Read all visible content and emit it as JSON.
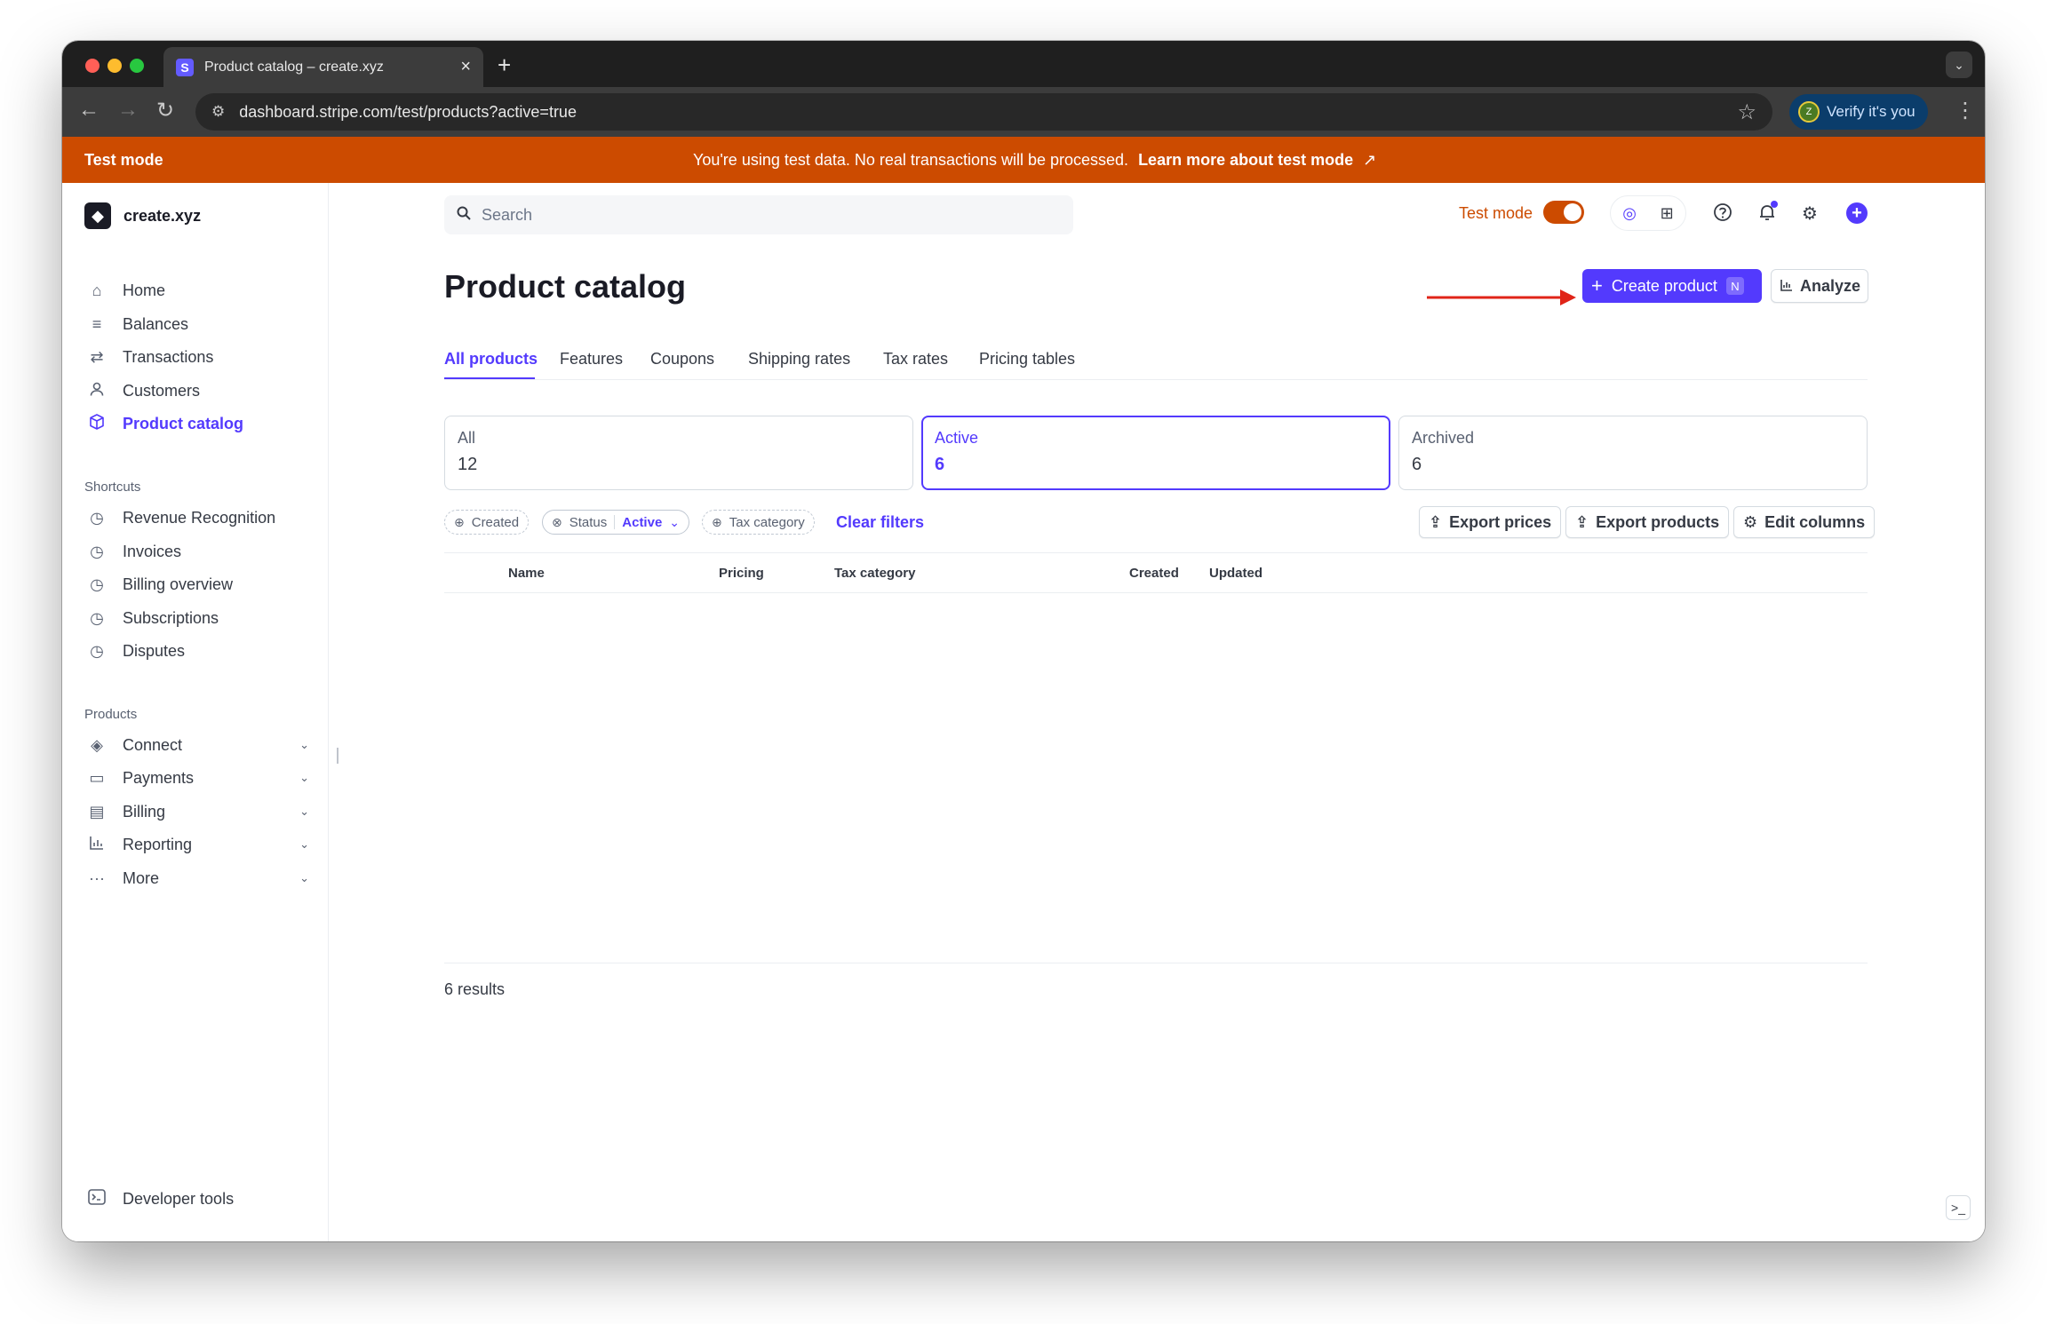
{
  "browser": {
    "tab_title": "Product catalog – create.xyz",
    "favicon_letter": "S",
    "url": "dashboard.stripe.com/test/products?active=true",
    "profile_label": "Verify it's you",
    "profile_initial": "Z"
  },
  "banner": {
    "left_label": "Test mode",
    "message": "You're using test data. No real transactions will be processed.",
    "link": "Learn more about test mode",
    "color": "#cc4b00"
  },
  "sidebar": {
    "account_name": "create.xyz",
    "items": [
      {
        "label": "Home",
        "icon": "home-icon"
      },
      {
        "label": "Balances",
        "icon": "balances-icon"
      },
      {
        "label": "Transactions",
        "icon": "transactions-icon"
      },
      {
        "label": "Customers",
        "icon": "customers-icon"
      },
      {
        "label": "Product catalog",
        "icon": "product-icon",
        "active": true
      }
    ],
    "shortcuts_title": "Shortcuts",
    "shortcuts": [
      {
        "label": "Revenue Recognition",
        "icon": "clock-icon"
      },
      {
        "label": "Invoices",
        "icon": "clock-icon"
      },
      {
        "label": "Billing overview",
        "icon": "clock-icon"
      },
      {
        "label": "Subscriptions",
        "icon": "clock-icon"
      },
      {
        "label": "Disputes",
        "icon": "clock-icon"
      }
    ],
    "products_title": "Products",
    "products": [
      {
        "label": "Connect",
        "icon": "connect-icon"
      },
      {
        "label": "Payments",
        "icon": "payments-icon"
      },
      {
        "label": "Billing",
        "icon": "billing-icon"
      },
      {
        "label": "Reporting",
        "icon": "reporting-icon"
      },
      {
        "label": "More",
        "icon": "more-icon"
      }
    ],
    "developer_tools": "Developer tools"
  },
  "header": {
    "search_placeholder": "Search",
    "test_mode_label": "Test mode",
    "test_mode_on": true
  },
  "page": {
    "title": "Product catalog",
    "create_button": "Create product",
    "create_shortcut": "N",
    "analyze_button": "Analyze",
    "tabs": [
      "All products",
      "Features",
      "Coupons",
      "Shipping rates",
      "Tax rates",
      "Pricing tables"
    ],
    "active_tab": "All products",
    "cards": [
      {
        "label": "All",
        "count": "12"
      },
      {
        "label": "Active",
        "count": "6",
        "selected": true
      },
      {
        "label": "Archived",
        "count": "6"
      }
    ],
    "filters": {
      "created": "Created",
      "status": "Status",
      "status_value": "Active",
      "tax_category": "Tax category",
      "clear": "Clear filters"
    },
    "actions": {
      "export_prices": "Export prices",
      "export_products": "Export products",
      "edit_columns": "Edit columns"
    },
    "columns": [
      "Name",
      "Pricing",
      "Tax category",
      "Created",
      "Updated"
    ],
    "results": "6 results"
  },
  "colors": {
    "accent": "#533afd",
    "annotation_arrow": "#e02418"
  }
}
